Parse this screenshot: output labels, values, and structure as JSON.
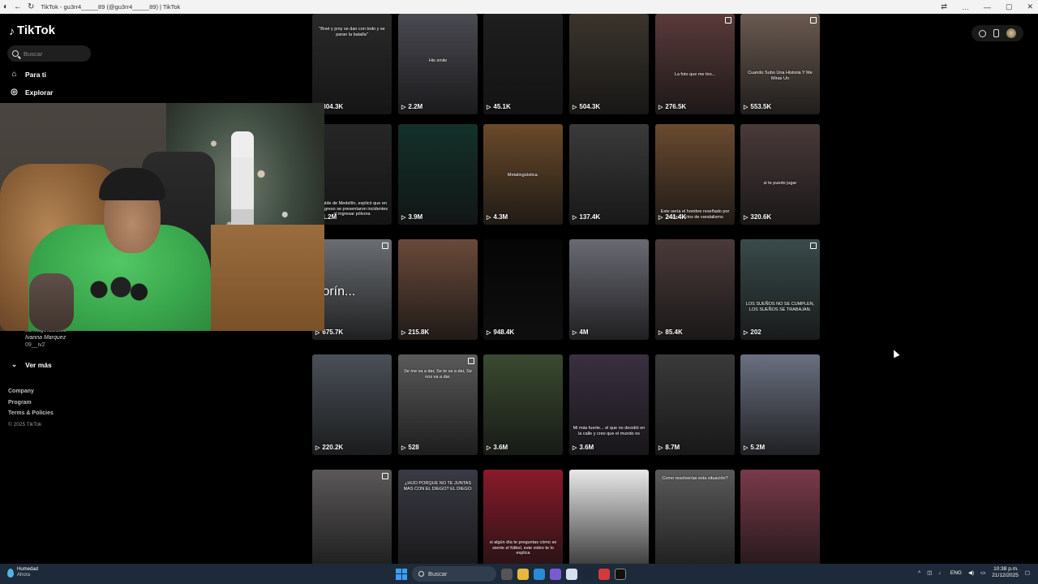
{
  "window": {
    "title": "TikTok - gu3rr4_____89 (@gu3rr4_____89) | TikTok",
    "controls": [
      "—",
      "▢",
      "✕"
    ]
  },
  "sidebar": {
    "brand": "TikTok",
    "search": {
      "placeholder": "Buscar",
      "value": ""
    },
    "nav": [
      {
        "label": "Para ti",
        "icon": "home-icon"
      },
      {
        "label": "Explorar",
        "icon": "compass-icon"
      }
    ],
    "following_user_partial": "santiago.alzate3",
    "following_user_name": "Ivanna Marquez",
    "following_user_handle": "09__iv2",
    "see_more": "Ver más",
    "footer": [
      "Company",
      "Program",
      "Terms & Policies"
    ],
    "copyright": "© 2025 TikTok"
  },
  "grid": {
    "rows": [
      [
        {
          "views": "804.3K",
          "caption": "\"Bnet y jony se dan con todo y se paran la batalla\"",
          "bg": "#2a2a2a"
        },
        {
          "views": "2.2M",
          "caption": "His smile",
          "bg": "#4a4a52"
        },
        {
          "views": "45.1K",
          "caption": "",
          "bg": "#1e1e1e"
        },
        {
          "views": "504.3K",
          "caption": "",
          "bg": "#3a342c"
        },
        {
          "views": "276.5K",
          "caption": "La foto que me tiro...",
          "bg": "#5a3a3a"
        },
        {
          "views": "553.5K",
          "caption": "Cuando Subo Una Historia Y Me Miras Un",
          "bg": "#6a5a50"
        }
      ],
      [
        {
          "views": "1.2M",
          "caption": "alcalde de Medellín, explicó que en el ingreso se presentaron incidentes al ingresar pólvora",
          "bg": "#262626"
        },
        {
          "views": "3.9M",
          "caption": "",
          "bg": "#14302a"
        },
        {
          "views": "4.3M",
          "caption": "Metalingüística.",
          "bg": "#6a4a2a"
        },
        {
          "views": "137.4K",
          "caption": "",
          "bg": "#3a3a3a"
        },
        {
          "views": "241.4K",
          "caption": "Este sería el hombre reseñado por realizar actos de vandalismo",
          "bg": "#6a4a30"
        },
        {
          "views": "320.6K",
          "caption": "si te puedo jugar",
          "bg": "#4a3a3a"
        }
      ],
      [
        {
          "views": "675.7K",
          "caption": "olorín...",
          "bg": "#6a6e72"
        },
        {
          "views": "215.8K",
          "caption": "",
          "bg": "#6a4a3a"
        },
        {
          "views": "948.4K",
          "caption": "",
          "bg": "#050505"
        },
        {
          "views": "4M",
          "caption": "",
          "bg": "#6a6a74"
        },
        {
          "views": "85.4K",
          "caption": "",
          "bg": "#4a3a3a"
        },
        {
          "views": "202",
          "caption": "LOS SUEÑOS NO SE CUMPLEN, LOS SUEÑOS SE TRABAJAN.",
          "bg": "#3a4a4a"
        }
      ],
      [
        {
          "views": "220.2K",
          "caption": "",
          "bg": "#4a5058"
        },
        {
          "views": "528",
          "caption": "Se me va a dar, Se te va a dar, Se nos va a dar.",
          "bg": "#5a5a5a"
        },
        {
          "views": "3.6M",
          "caption": "",
          "bg": "#3a4a30"
        },
        {
          "views": "3.6M",
          "caption": "Mi más fuerte... el que no decidió en la calle y creo que el mundo es",
          "bg": "#3a3040"
        },
        {
          "views": "8.7M",
          "caption": "",
          "bg": "#3a3a3a"
        },
        {
          "views": "5.2M",
          "caption": "",
          "bg": "#6a7080"
        }
      ],
      [
        {
          "views": "",
          "caption": "",
          "bg": "#5a5858"
        },
        {
          "views": "",
          "caption": "¿HIJO PORQUE NO TE JUNTAS MAS CON EL DIEGO? EL DIEGO:",
          "bg": "#3a3a44"
        },
        {
          "views": "",
          "caption": "si algún día te preguntas cómo se siente el fútbol, este video te lo explica",
          "bg": "#8a1a2a"
        },
        {
          "views": "",
          "caption": "",
          "bg": "#e8e8e8"
        },
        {
          "views": "",
          "caption": "Como resolverías esta situación?",
          "bg": "#5a5a5a"
        },
        {
          "views": "",
          "caption": "",
          "bg": "#7a3a4a"
        }
      ]
    ]
  },
  "taskbar": {
    "weather_title": "Humedad",
    "weather_sub": "Ahora",
    "search_label": "Buscar",
    "lang": "ENG",
    "time": "10:38 p.m.",
    "date": "21/12/2025"
  }
}
